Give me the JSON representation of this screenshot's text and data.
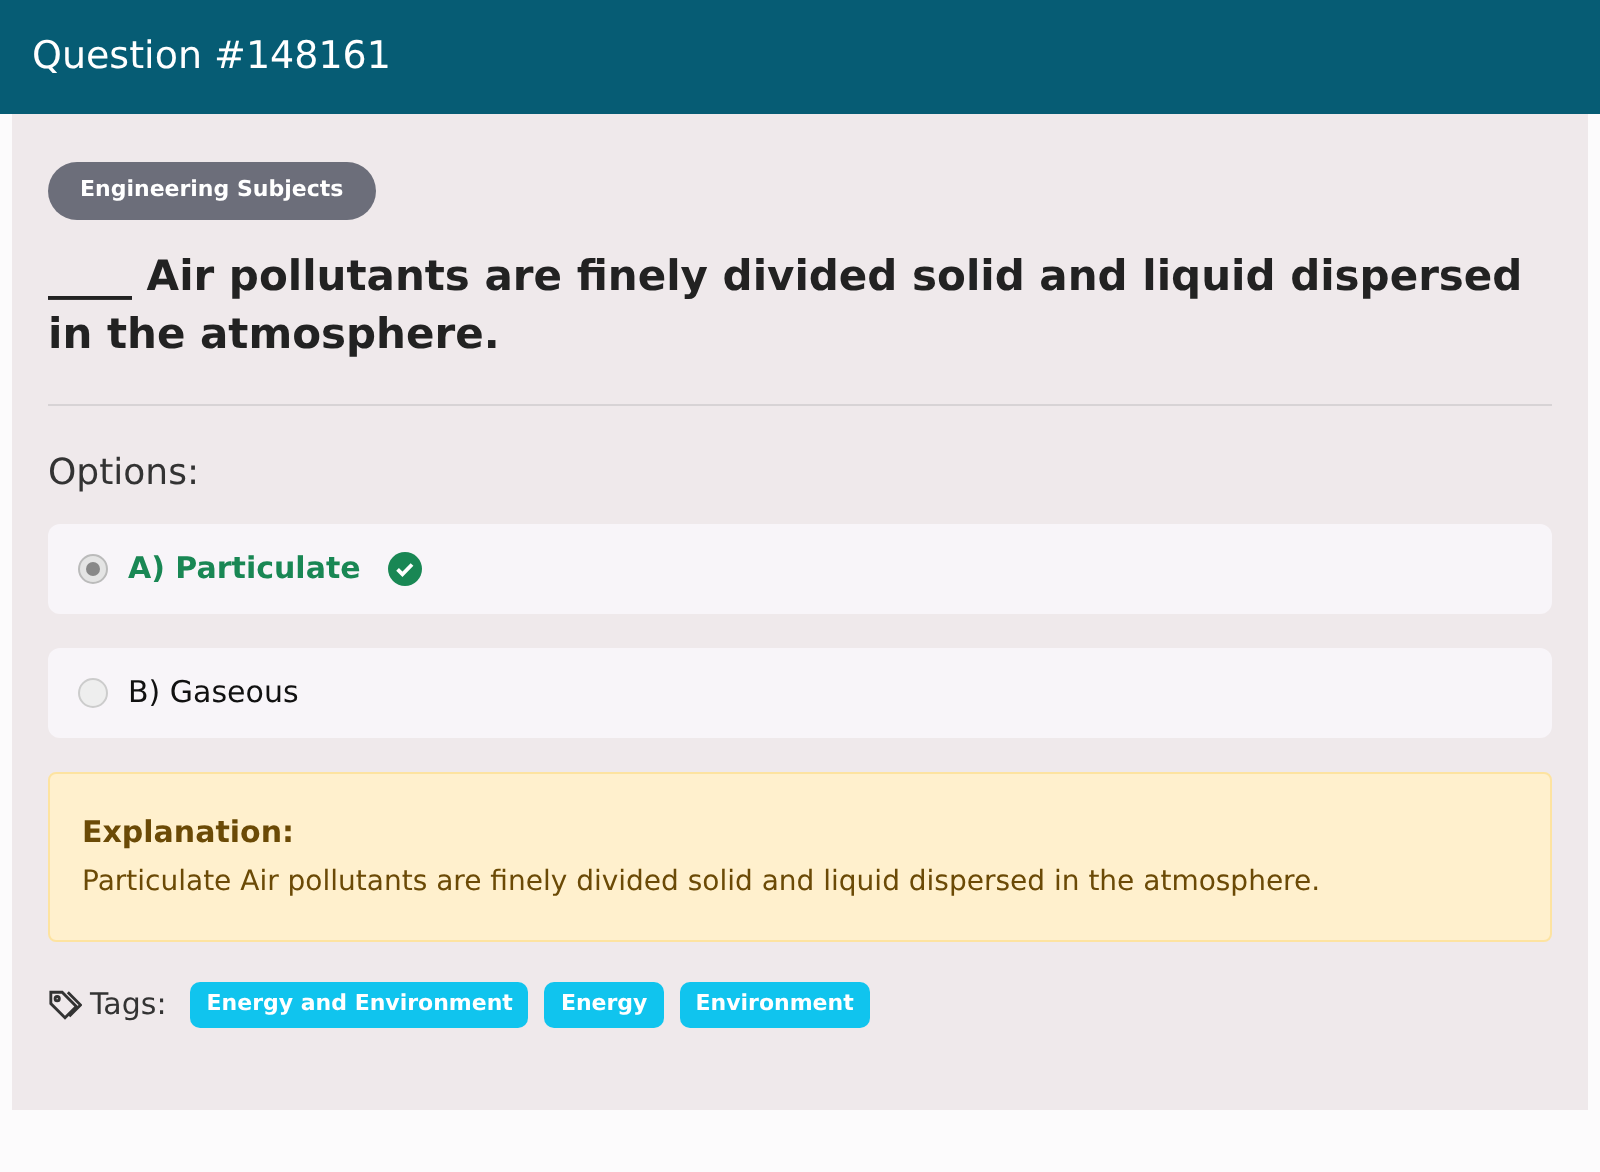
{
  "header": {
    "title": "Question #148161"
  },
  "category": "Engineering Subjects",
  "question": "____ Air pollutants are finely divided solid and liquid dispersed in the atmosphere.",
  "options_label": "Options:",
  "options": [
    {
      "label": "A) Particulate",
      "selected": true,
      "correct": true
    },
    {
      "label": "B) Gaseous",
      "selected": false,
      "correct": false
    }
  ],
  "explanation": {
    "title": "Explanation:",
    "text": "Particulate Air pollutants are finely divided solid and liquid dispersed in the atmosphere."
  },
  "tags_label": "Tags:",
  "tags": [
    "Energy and Environment",
    "Energy",
    "Environment"
  ]
}
